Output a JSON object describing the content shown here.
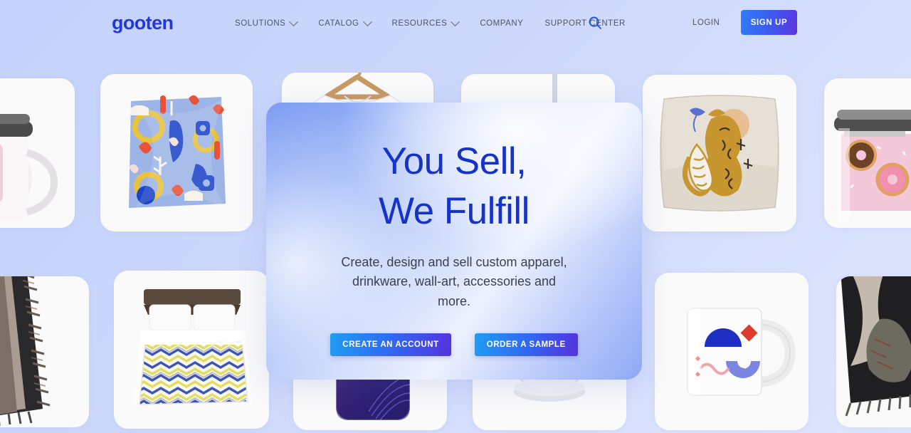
{
  "brand": {
    "logo_text": "gooten",
    "accent_blue": "#2438d8",
    "headline_blue": "#1633c9",
    "page_bg": "#c8d5fb"
  },
  "nav": {
    "items": [
      {
        "label": "SOLUTIONS",
        "has_caret": true
      },
      {
        "label": "CATALOG",
        "has_caret": true
      },
      {
        "label": "RESOURCES",
        "has_caret": true
      },
      {
        "label": "COMPANY",
        "has_caret": false
      },
      {
        "label": "SUPPORT CENTER",
        "has_caret": false
      }
    ],
    "search_icon": "search-icon",
    "login_label": "LOGIN",
    "signup_label": "SIGN UP",
    "signup_gradient": "#2f7df6 → #5b35e0"
  },
  "hero": {
    "title_line1": "You Sell,",
    "title_line2": "We Fulfill",
    "subtitle": "Create, design and sell custom apparel, drinkware, wall-art, accessories and more.",
    "primary_cta": "CREATE AN ACCOUNT",
    "secondary_cta": "ORDER A SAMPLE",
    "cta_gradient": "#1f9df2 → #5531dd"
  },
  "tiles": [
    {
      "name": "tile-insulated-mug",
      "product": "white insulated travel mug with pink lid"
    },
    {
      "name": "tile-patterned-fabric",
      "product": "blue abstract patterned folded fabric"
    },
    {
      "name": "tile-tshirt-hanger",
      "product": "white t-shirt on wooden hanger"
    },
    {
      "name": "tile-glass-tumbler",
      "product": "glass tumbler with straw and floral print"
    },
    {
      "name": "tile-tiger-pillow",
      "product": "beige pillow with gold tiger illustration"
    },
    {
      "name": "tile-donut-tumbler",
      "product": "pink donut print stainless tumbler"
    },
    {
      "name": "tile-fringe-blanket",
      "product": "fringed woven throw blanket"
    },
    {
      "name": "tile-chevron-bedding",
      "product": "bed with yellow and blue chevron duvet"
    },
    {
      "name": "tile-phone-case",
      "product": "gradient pink purple phone case"
    },
    {
      "name": "tile-snow-globe",
      "product": "glass snow globe ornament"
    },
    {
      "name": "tile-geometric-mug",
      "product": "white mug with blue geometric artwork"
    },
    {
      "name": "tile-black-blanket",
      "product": "black and beige fringed blanket"
    }
  ]
}
